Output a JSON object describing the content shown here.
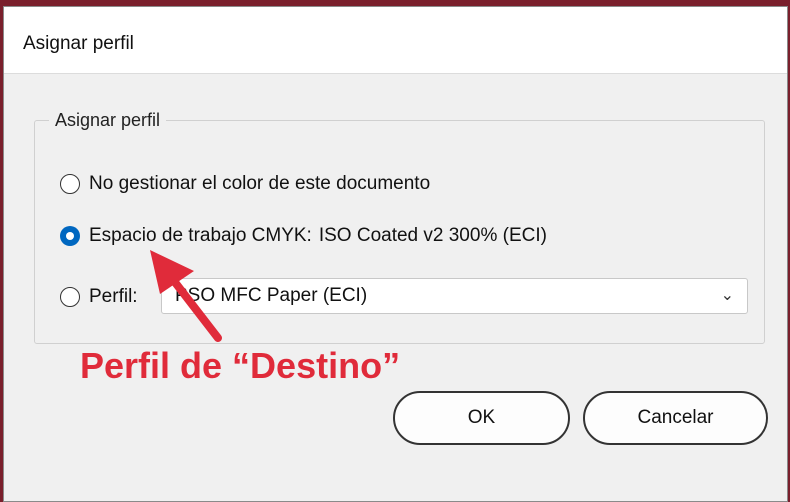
{
  "dialog": {
    "title": "Asignar perfil",
    "group_label": "Asignar perfil",
    "options": [
      {
        "label": "No gestionar el color de este documento",
        "checked": false
      },
      {
        "label": "Espacio de trabajo CMYK:",
        "value": "ISO Coated v2 300% (ECI)",
        "checked": true
      },
      {
        "label": "Perfil:",
        "checked": false
      }
    ],
    "profile_select": {
      "selected": "PSO MFC Paper (ECI)"
    },
    "buttons": {
      "ok": "OK",
      "cancel": "Cancelar"
    }
  },
  "annotation": {
    "text": "Perfil de “Destino”",
    "color": "#e02b3a"
  },
  "colors": {
    "radio_selected": "#0067c0",
    "dialog_bg": "#f0f0f0"
  }
}
